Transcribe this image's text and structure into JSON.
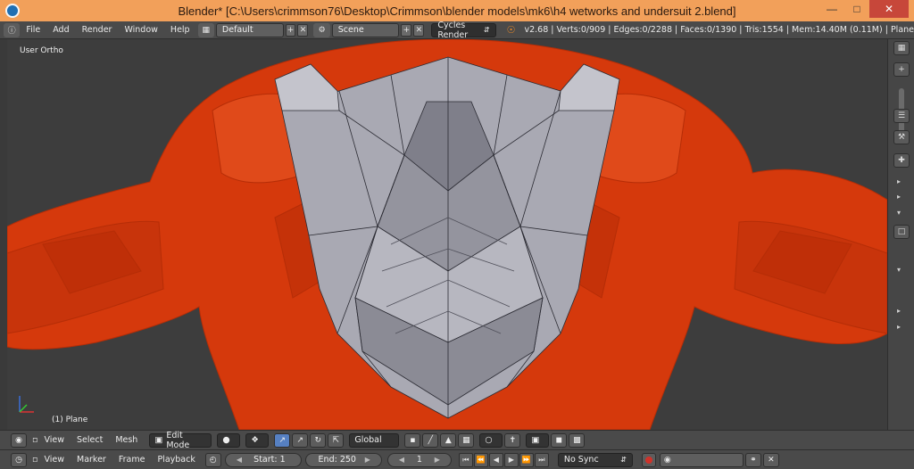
{
  "window": {
    "title": "Blender* [C:\\Users\\crimmson76\\Desktop\\Crimmson\\blender models\\mk6\\h4 wetworks and undersuit 2.blend]",
    "buttons": [
      "minimize-icon",
      "maximize-icon",
      "close-icon"
    ]
  },
  "info_header": {
    "menus": [
      "File",
      "Add",
      "Render",
      "Window",
      "Help"
    ],
    "screen_layout": "Default",
    "scene": "Scene",
    "render_engine": "Cycles Render",
    "stats": "v2.68 | Verts:0/909 | Edges:0/2288 | Faces:0/1390 | Tris:1554 | Mem:14.40M (0.11M) | Plane"
  },
  "viewport": {
    "view_name": "User Ortho",
    "object_label": "(1) Plane",
    "mesh_colors": {
      "body": "#d5390c",
      "armor": "#a9a9b3",
      "background": "#3d3d3d"
    }
  },
  "view3d_header": {
    "menus": [
      "View",
      "Select",
      "Mesh"
    ],
    "mode": "Edit Mode",
    "orientation": "Global"
  },
  "timeline_header": {
    "menus": [
      "View",
      "Marker",
      "Frame",
      "Playback"
    ],
    "start_label": "Start: 1",
    "end_label": "End: 250",
    "current_frame": "1",
    "sync": "No Sync"
  }
}
